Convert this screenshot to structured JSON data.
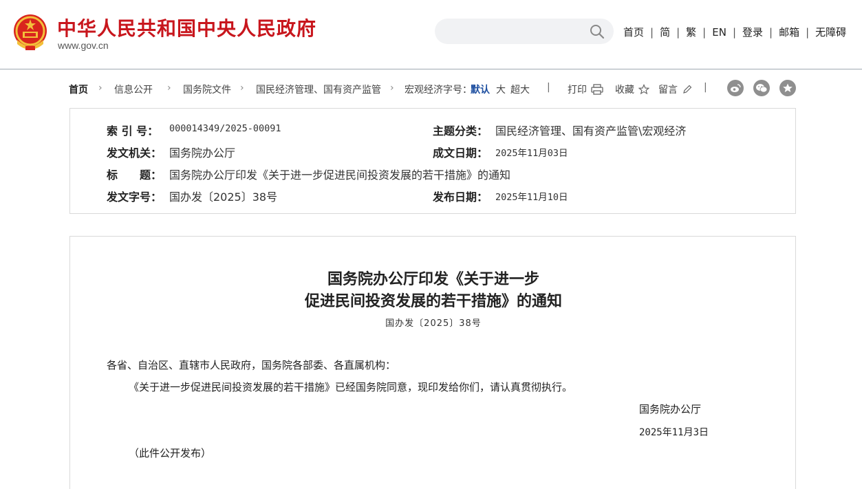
{
  "header": {
    "site_name": "中华人民共和国中央人民政府",
    "site_domain": "www.gov.cn",
    "search_placeholder": "",
    "nav": [
      "首页",
      "简",
      "繁",
      "EN",
      "登录",
      "邮箱",
      "无障碍"
    ],
    "nav_separator": "|",
    "brand_color": "#c8161d"
  },
  "breadcrumb": {
    "items": [
      "首页",
      "信息公开",
      "国务院文件",
      "国民经济管理、国有资产监管",
      "宏观经济"
    ],
    "font_size_label": "字号：",
    "font_size_options": [
      "默认",
      "大",
      "超大"
    ],
    "active_font_size": "默认",
    "tools": [
      "打印",
      "收藏",
      "留言"
    ],
    "bar_separator": "|",
    "share_icons": [
      "weibo-icon",
      "wechat-icon",
      "favorite-star-icon"
    ]
  },
  "meta": {
    "index_no_label": "索 引 号：",
    "index_no": "000014349/2025-00091",
    "topic_label": "主题分类：",
    "topic": "国民经济管理、国有资产监管\\宏观经济",
    "issuer_label": "发文机关：",
    "issuer": "国务院办公厅",
    "written_date_label": "成文日期：",
    "written_date": "2025年11月03日",
    "title_label": "标　　题：",
    "title": "国务院办公厅印发《关于进一步促进民间投资发展的若干措施》的通知",
    "doc_no_label": "发文字号：",
    "doc_no": "国办发〔2025〕38号",
    "publish_date_label": "发布日期：",
    "publish_date": "2025年11月10日"
  },
  "article": {
    "title_line1": "国务院办公厅印发《关于进一步",
    "title_line2": "促进民间投资发展的若干措施》的通知",
    "doc_no": "国办发〔2025〕38号",
    "salutation": "各省、自治区、直辖市人民政府，国务院各部委、各直属机构：",
    "body": "《关于进一步促进民间投资发展的若干措施》已经国务院同意，现印发给你们，请认真贯彻执行。",
    "signature": "国务院办公厅",
    "date": "2025年11月3日",
    "note": "（此件公开发布）"
  }
}
